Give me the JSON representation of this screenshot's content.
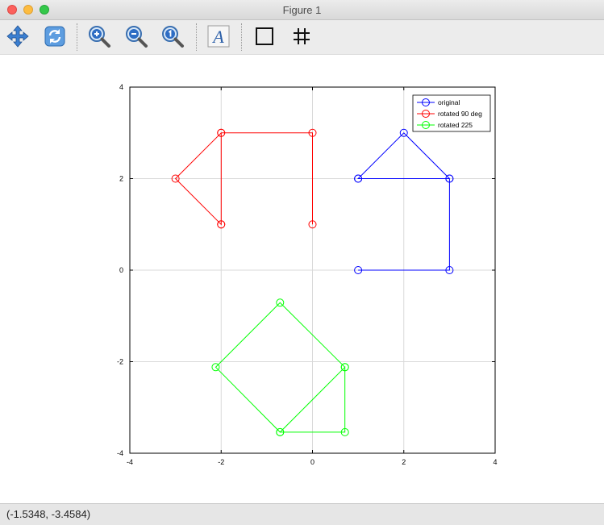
{
  "window": {
    "title": "Figure 1"
  },
  "toolbar": {
    "items": [
      {
        "name": "pan-tool-button",
        "icon": "pan-arrows-icon"
      },
      {
        "name": "rotate-tool-button",
        "icon": "rotate-icon"
      },
      {
        "name": "zoom-in-button",
        "icon": "zoom-in-icon"
      },
      {
        "name": "zoom-out-button",
        "icon": "zoom-out-icon"
      },
      {
        "name": "zoom-reset-button",
        "icon": "zoom-one-icon"
      },
      {
        "name": "text-tool-button",
        "icon": "text-a-icon"
      },
      {
        "name": "box-tool-button",
        "icon": "square-icon"
      },
      {
        "name": "grid-toggle-button",
        "icon": "grid-icon"
      }
    ]
  },
  "status": {
    "coords": "(-1.5348, -3.4584)"
  },
  "chart_data": {
    "type": "line",
    "xlim": [
      -4,
      4
    ],
    "ylim": [
      -4,
      4
    ],
    "xticks": [
      "-4",
      "-2",
      "0",
      "2",
      "4"
    ],
    "yticks": [
      "-4",
      "-2",
      "0",
      "2",
      "4"
    ],
    "grid": true,
    "legend_position": "top-right",
    "series": [
      {
        "name": "original",
        "color": "#0000ff",
        "x": [
          1,
          3,
          3,
          1,
          1,
          2,
          3
        ],
        "y": [
          0,
          0,
          2,
          2,
          2,
          3,
          2
        ]
      },
      {
        "name": "rotated 90 deg",
        "color": "#ff0000",
        "x": [
          0,
          0,
          -2,
          -2,
          -2,
          -3,
          -2
        ],
        "y": [
          1,
          3,
          3,
          1,
          1,
          2,
          3
        ]
      },
      {
        "name": "rotated 225",
        "color": "#00ff00",
        "x": [
          -0.71,
          0.71,
          0.71,
          -0.71,
          -0.71,
          -2.12,
          -0.71
        ],
        "y": [
          -3.54,
          -3.54,
          -2.12,
          -3.54,
          -3.54,
          -2.12,
          -0.71
        ],
        "x_full": [
          -0.71,
          0.71,
          0.71,
          -0.71,
          -2.12,
          -0.71,
          0.71
        ],
        "y_full": [
          -3.54,
          -3.54,
          -2.12,
          -3.54,
          -2.12,
          -0.71,
          -2.12
        ]
      }
    ]
  }
}
